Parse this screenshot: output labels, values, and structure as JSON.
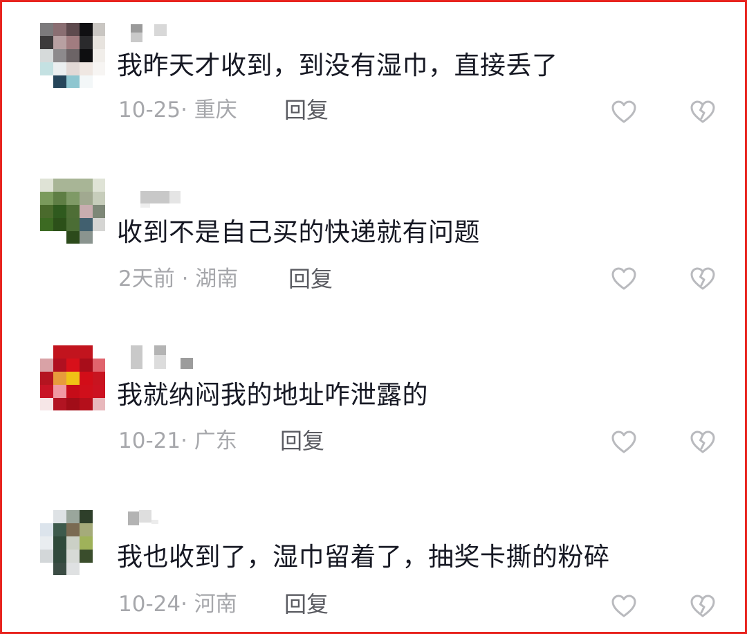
{
  "comments": [
    {
      "text": "我昨天才收到，到没有湿巾，直接丢了",
      "meta": "10-25· 重庆",
      "reply": "回复",
      "like_icon": "heart-icon",
      "dislike_icon": "broken-heart-icon"
    },
    {
      "text": "收到不是自己买的快递就有问题",
      "meta": "2天前 · 湖南",
      "reply": "回复",
      "like_icon": "heart-icon",
      "dislike_icon": "broken-heart-icon"
    },
    {
      "text": "我就纳闷我的地址咋泄露的",
      "meta": "10-21· 广东",
      "reply": "回复",
      "like_icon": "heart-icon",
      "dislike_icon": "broken-heart-icon"
    },
    {
      "text": "我也收到了，湿巾留着了，抽奖卡撕的粉碎",
      "meta": "10-24· 河南",
      "reply": "回复",
      "like_icon": "heart-icon",
      "dislike_icon": "broken-heart-icon"
    }
  ],
  "colors": {
    "border": "#e8241f",
    "text": "#161823",
    "meta": "#a6a7ab",
    "reply": "#5a5b61",
    "icon": "#b9babe"
  }
}
